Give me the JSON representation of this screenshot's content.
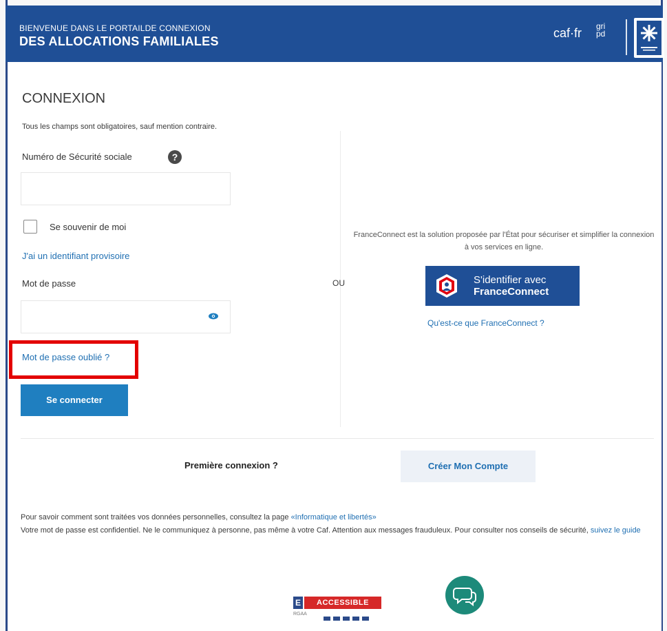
{
  "header": {
    "subtitle": "BIENVENUE DANS LE PORTAILDE CONNEXION",
    "title": "DES ALLOCATIONS FAMILIALES",
    "brand": "caf·fr",
    "brand_small": "gri pd"
  },
  "login": {
    "heading": "CONNEXION",
    "required_note": "Tous les champs sont obligatoires, sauf mention contraire.",
    "nss_label": "Numéro de Sécurité sociale",
    "nss_value": "",
    "remember_label": "Se souvenir de moi",
    "provisional_link": "J'ai un identifiant provisoire",
    "password_label": "Mot de passe",
    "password_value": "",
    "forgot_link": "Mot de passe oublié ?",
    "submit_label": "Se connecter"
  },
  "separator": "OU",
  "franceconnect": {
    "description": "FranceConnect est la solution proposée par l'État pour sécuriser et simplifier la connexion à vos services en ligne.",
    "button_line1": "S'identifier avec",
    "button_line2": "FranceConnect",
    "what_link": "Qu'est-ce que FranceConnect ?"
  },
  "signup": {
    "first_connection": "Première connexion ?",
    "create_label": "Créer Mon Compte"
  },
  "legal": {
    "line1_text": "Pour savoir comment sont traitées vos données personnelles, consultez la page ",
    "line1_link": "«Informatique et libertés»",
    "line2_text": "Votre mot de passe est confidentiel. Ne le communiquez à personne, pas même à votre Caf. Attention aux messages frauduleux. Pour consulter nos conseils de sécurité, ",
    "line2_link": "suivez le guide"
  },
  "footer": {
    "accessible_e": "E",
    "accessible_label": "ACCESSIBLE",
    "accessible_sub": "RGAA"
  },
  "colors": {
    "header_blue": "#1f4f96",
    "primary_button": "#1f7fc0",
    "link": "#1f6fb2",
    "highlight": "#e30000"
  }
}
